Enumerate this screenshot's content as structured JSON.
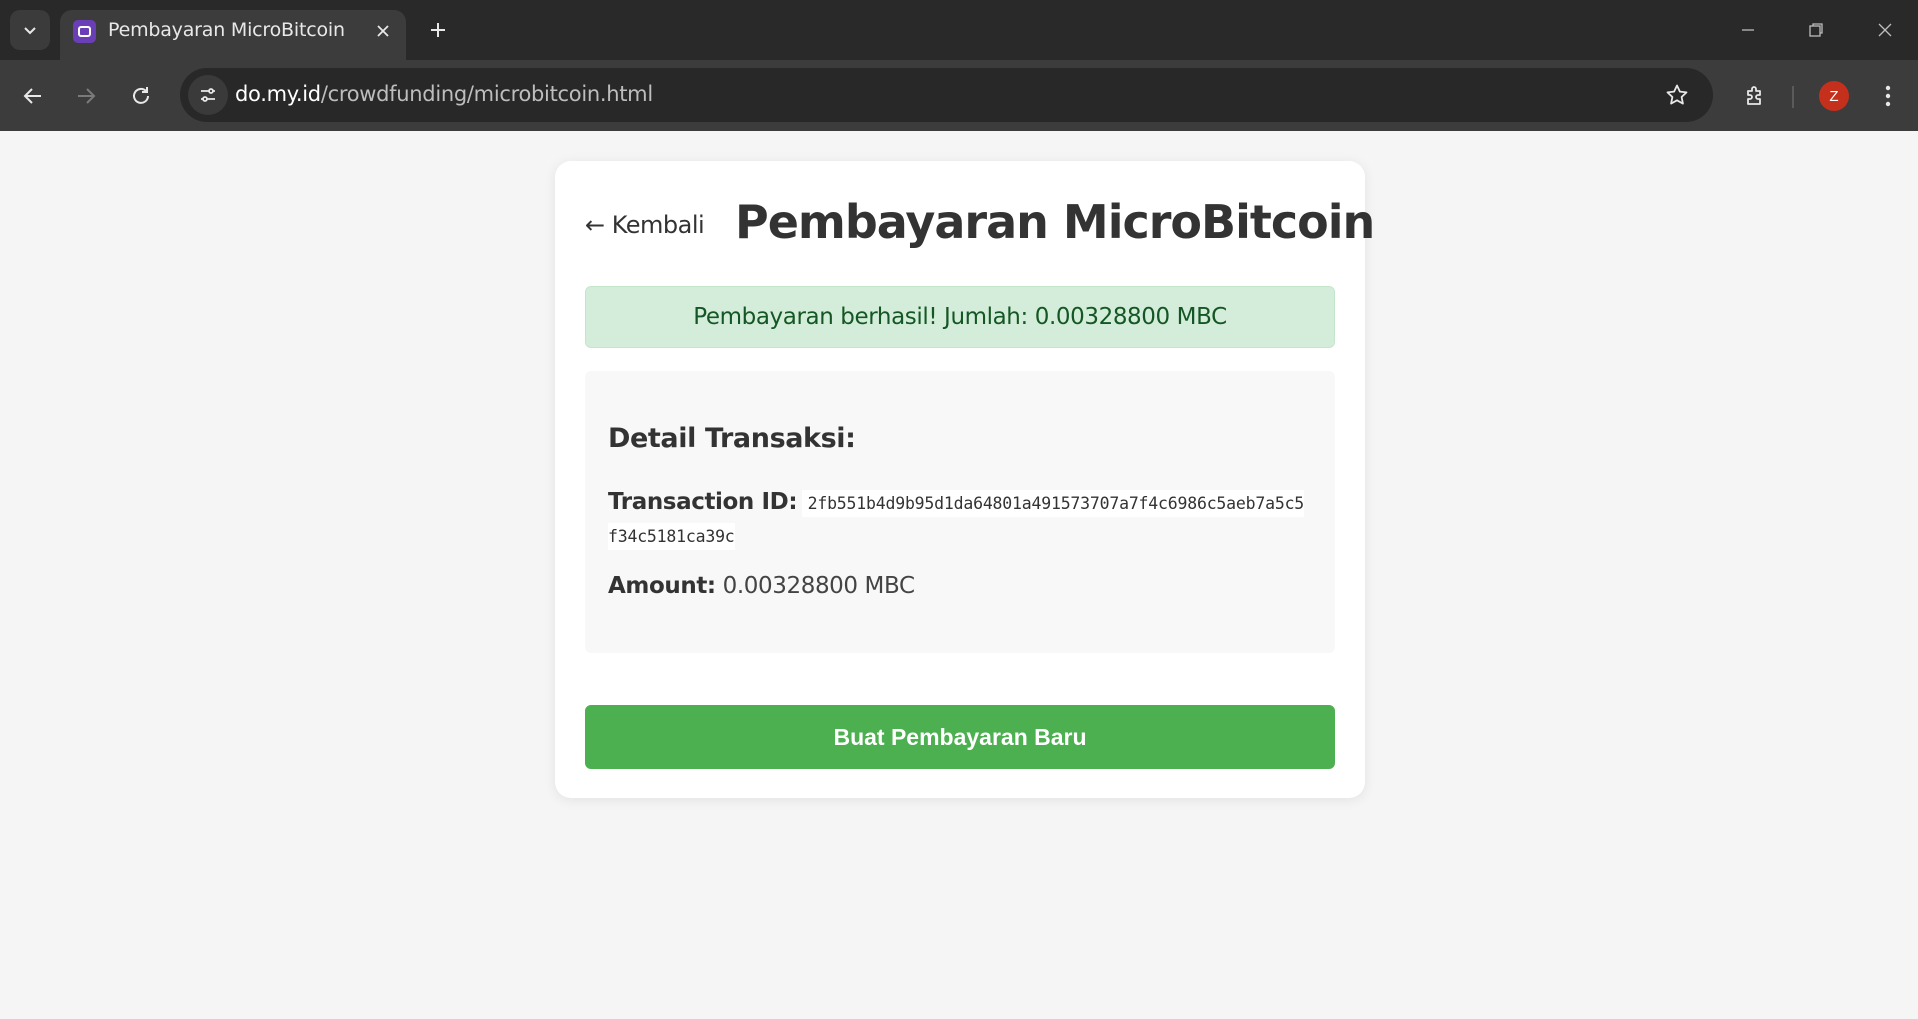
{
  "browser": {
    "tab_title": "Pembayaran MicroBitcoin",
    "url_domain": "do.my.id",
    "url_path": "/crowdfunding/microbitcoin.html",
    "profile_initial": "Z"
  },
  "page": {
    "back_label": "← Kembali",
    "title": "Pembayaran MicroBitcoin",
    "success_message": "Pembayaran berhasil! Jumlah: 0.00328800 MBC",
    "details": {
      "heading": "Detail Transaksi:",
      "txid_label": "Transaction ID:",
      "txid_value": "2fb551b4d9b95d1da64801a491573707a7f4c6986c5aeb7a5c5f34c5181ca39c",
      "amount_label": "Amount:",
      "amount_value": "0.00328800 MBC"
    },
    "new_payment_label": "Buat Pembayaran Baru"
  },
  "colors": {
    "success_bg": "#d4edda",
    "success_text": "#155724",
    "button": "#4caf50",
    "avatar": "#c5301c"
  }
}
